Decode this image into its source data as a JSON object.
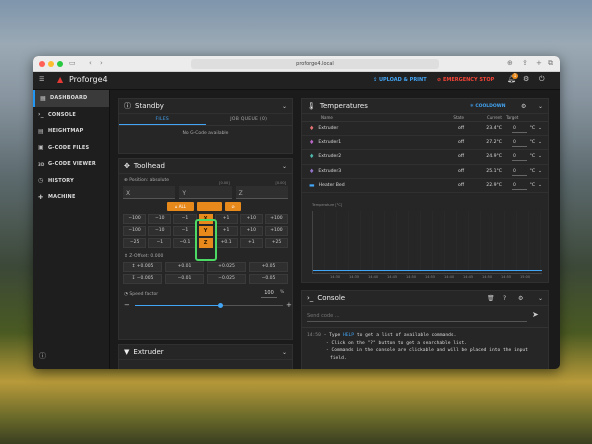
{
  "safari": {
    "url": "proforge4.local"
  },
  "topbar": {
    "title": "Proforge4",
    "upload": "UPLOAD & PRINT",
    "estop": "EMERGENCY STOP",
    "badge": "1"
  },
  "sidebar": {
    "items": [
      {
        "label": "DASHBOARD",
        "icon": "dashboard-icon"
      },
      {
        "label": "CONSOLE",
        "icon": "console-icon"
      },
      {
        "label": "HEIGHTMAP",
        "icon": "heightmap-icon"
      },
      {
        "label": "G-CODE FILES",
        "icon": "files-icon"
      },
      {
        "label": "G-CODE VIEWER",
        "icon": "3d-icon"
      },
      {
        "label": "HISTORY",
        "icon": "history-icon"
      },
      {
        "label": "MACHINE",
        "icon": "machine-icon"
      }
    ]
  },
  "standby": {
    "title": "Standby",
    "tab_files": "FILES",
    "tab_queue": "JOB QUEUE (0)",
    "empty": "No G-Code available"
  },
  "toolhead": {
    "title": "Toolhead",
    "position_label": "Position: absolute",
    "axes": [
      {
        "name": "X",
        "val": ""
      },
      {
        "name": "Y",
        "val": "[0.00]"
      },
      {
        "name": "Z",
        "val": "[0.00]"
      }
    ],
    "home_all": "ALL",
    "jog_rows": [
      {
        "left": [
          "−100",
          "−10",
          "−1"
        ],
        "axis": "X",
        "right": [
          "+1",
          "+10",
          "+100"
        ]
      },
      {
        "left": [
          "−100",
          "−10",
          "−1"
        ],
        "axis": "Y",
        "right": [
          "+1",
          "+10",
          "+100"
        ]
      },
      {
        "left": [
          "−25",
          "−1",
          "−0.1"
        ],
        "axis": "Z",
        "right": [
          "+0.1",
          "+1",
          "+25"
        ]
      }
    ],
    "zoffset_label": "Z-Offset: 0.000",
    "zoffset_up": [
      "+0.005",
      "+0.01",
      "+0.025",
      "+0.05"
    ],
    "zoffset_down": [
      "−0.005",
      "−0.01",
      "−0.025",
      "−0.05"
    ],
    "speed_label": "Speed factor",
    "speed_value": "100",
    "speed_unit": "%",
    "speed_fraction": 0.58
  },
  "extruder_panel": {
    "title": "Extruder"
  },
  "temperatures": {
    "title": "Temperatures",
    "cooldown": "COOLDOWN",
    "headers": {
      "name": "Name",
      "state": "State",
      "current": "Current",
      "target": "Target"
    },
    "rows": [
      {
        "name": "Extruder",
        "state": "off",
        "current": "23.4°C",
        "target": "0",
        "unit": "°C",
        "color": "#e57373"
      },
      {
        "name": "Extruder1",
        "state": "off",
        "current": "27.2°C",
        "target": "0",
        "unit": "°C",
        "color": "#ba68c8"
      },
      {
        "name": "Extruder2",
        "state": "off",
        "current": "24.9°C",
        "target": "0",
        "unit": "°C",
        "color": "#4db6ac"
      },
      {
        "name": "Extruder3",
        "state": "off",
        "current": "25.1°C",
        "target": "0",
        "unit": "°C",
        "color": "#9575cd"
      },
      {
        "name": "Heater Bed",
        "state": "off",
        "current": "22.9°C",
        "target": "0",
        "unit": "°C",
        "color": "#42a5f5"
      }
    ],
    "chart_ylabel": "Temperature [°C]",
    "chart_xticks": [
      "14:30",
      "14:35",
      "14:40",
      "14:45",
      "14:50",
      "14:55",
      "14:40",
      "14:45",
      "14:50",
      "14:55",
      "15:00"
    ]
  },
  "console": {
    "title": "Console",
    "placeholder": "Send code ...",
    "time": "14:50",
    "line1a": "- Type ",
    "line1kw": "HELP",
    "line1b": " to get a list of available commands.",
    "line2": "- Click on the \"?\" button to get a searchable list.",
    "line3": "- Commands in the console are clickable and will be placed into the input",
    "line4": "field."
  },
  "colors": {
    "accent": "#2196f3",
    "orange": "#e8891c",
    "estop": "#f44336",
    "highlight": "#4cd964"
  }
}
